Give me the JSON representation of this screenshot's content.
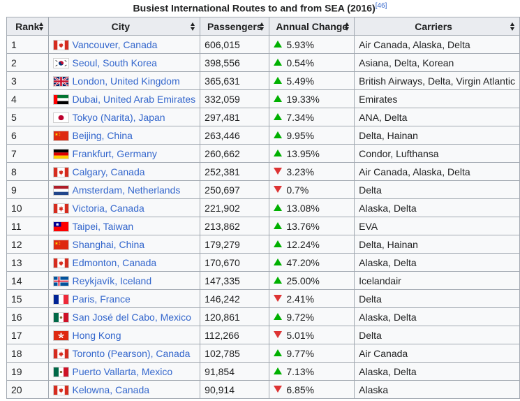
{
  "caption": {
    "title": "Busiest International Routes to and from SEA (2016)",
    "ref": "[46]"
  },
  "columns": {
    "rank": "Rank",
    "city": "City",
    "passengers": "Passengers",
    "change": "Annual Change",
    "carriers": "Carriers"
  },
  "colors": {
    "up": "#00b000",
    "down": "#dd3333",
    "link": "#3366cc",
    "header_bg": "#eaecf0",
    "cell_bg": "#f8f9fa",
    "border": "#a2a9b1"
  },
  "rows": [
    {
      "rank": "1",
      "flag": "canada-flag-icon",
      "city": "Vancouver, Canada",
      "passengers": "606,015",
      "dir": "up",
      "change": "5.93%",
      "carriers": "Air Canada, Alaska, Delta"
    },
    {
      "rank": "2",
      "flag": "south-korea-flag-icon",
      "city": "Seoul, South Korea",
      "passengers": "398,556",
      "dir": "up",
      "change": "0.54%",
      "carriers": "Asiana, Delta, Korean"
    },
    {
      "rank": "3",
      "flag": "uk-flag-icon",
      "city": "London, United Kingdom",
      "passengers": "365,631",
      "dir": "up",
      "change": "5.49%",
      "carriers": "British Airways, Delta, Virgin Atlantic"
    },
    {
      "rank": "4",
      "flag": "uae-flag-icon",
      "city": "Dubai, United Arab Emirates",
      "passengers": "332,059",
      "dir": "up",
      "change": "19.33%",
      "carriers": "Emirates"
    },
    {
      "rank": "5",
      "flag": "japan-flag-icon",
      "city": "Tokyo (Narita), Japan",
      "passengers": "297,481",
      "dir": "up",
      "change": "7.34%",
      "carriers": "ANA, Delta"
    },
    {
      "rank": "6",
      "flag": "china-flag-icon",
      "city": "Beijing, China",
      "passengers": "263,446",
      "dir": "up",
      "change": "9.95%",
      "carriers": "Delta, Hainan"
    },
    {
      "rank": "7",
      "flag": "germany-flag-icon",
      "city": "Frankfurt, Germany",
      "passengers": "260,662",
      "dir": "up",
      "change": "13.95%",
      "carriers": "Condor, Lufthansa"
    },
    {
      "rank": "8",
      "flag": "canada-flag-icon",
      "city": "Calgary, Canada",
      "passengers": "252,381",
      "dir": "down",
      "change": "3.23%",
      "carriers": "Air Canada, Alaska, Delta"
    },
    {
      "rank": "9",
      "flag": "netherlands-flag-icon",
      "city": "Amsterdam, Netherlands",
      "passengers": "250,697",
      "dir": "down",
      "change": "0.7%",
      "carriers": "Delta"
    },
    {
      "rank": "10",
      "flag": "canada-flag-icon",
      "city": "Victoria, Canada",
      "passengers": "221,902",
      "dir": "up",
      "change": "13.08%",
      "carriers": "Alaska, Delta"
    },
    {
      "rank": "11",
      "flag": "taiwan-flag-icon",
      "city": "Taipei, Taiwan",
      "passengers": "213,862",
      "dir": "up",
      "change": "13.76%",
      "carriers": "EVA"
    },
    {
      "rank": "12",
      "flag": "china-flag-icon",
      "city": "Shanghai, China",
      "passengers": "179,279",
      "dir": "up",
      "change": "12.24%",
      "carriers": "Delta, Hainan"
    },
    {
      "rank": "13",
      "flag": "canada-flag-icon",
      "city": "Edmonton, Canada",
      "passengers": "170,670",
      "dir": "up",
      "change": "47.20%",
      "carriers": "Alaska, Delta"
    },
    {
      "rank": "14",
      "flag": "iceland-flag-icon",
      "city": "Reykjavík, Iceland",
      "passengers": "147,335",
      "dir": "up",
      "change": "25.00%",
      "carriers": "Icelandair"
    },
    {
      "rank": "15",
      "flag": "france-flag-icon",
      "city": "Paris, France",
      "passengers": "146,242",
      "dir": "down",
      "change": "2.41%",
      "carriers": "Delta"
    },
    {
      "rank": "16",
      "flag": "mexico-flag-icon",
      "city": "San José del Cabo, Mexico",
      "passengers": "120,861",
      "dir": "up",
      "change": "9.72%",
      "carriers": "Alaska, Delta"
    },
    {
      "rank": "17",
      "flag": "hong-kong-flag-icon",
      "city": "Hong Kong",
      "passengers": "112,266",
      "dir": "down",
      "change": "5.01%",
      "carriers": "Delta"
    },
    {
      "rank": "18",
      "flag": "canada-flag-icon",
      "city": "Toronto (Pearson), Canada",
      "passengers": "102,785",
      "dir": "up",
      "change": "9.77%",
      "carriers": "Air Canada"
    },
    {
      "rank": "19",
      "flag": "mexico-flag-icon",
      "city": "Puerto Vallarta, Mexico",
      "passengers": "91,854",
      "dir": "up",
      "change": "7.13%",
      "carriers": "Alaska, Delta"
    },
    {
      "rank": "20",
      "flag": "canada-flag-icon",
      "city": "Kelowna, Canada",
      "passengers": "90,914",
      "dir": "down",
      "change": "6.85%",
      "carriers": "Alaska"
    }
  ]
}
